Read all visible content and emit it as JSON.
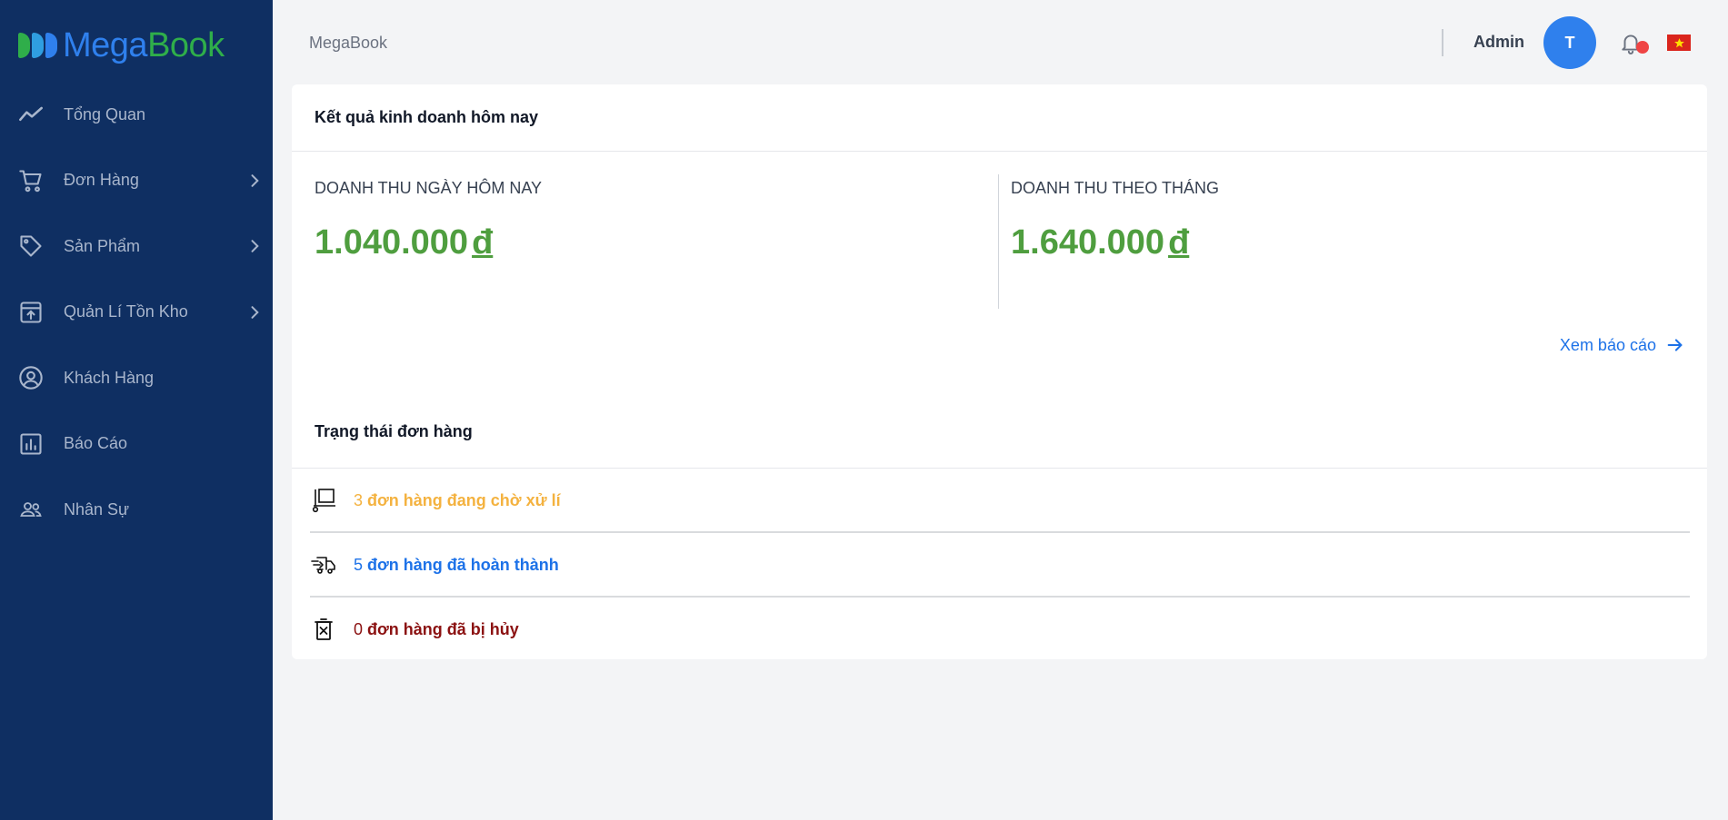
{
  "brand": {
    "name_part1": "Mega",
    "name_part2": "Book",
    "colors": {
      "mega": "#2f80ed",
      "book": "#2fae4a"
    }
  },
  "sidebar": {
    "background": "#0f2f62",
    "items": [
      {
        "label": "Tổng Quan",
        "icon": "trend-line-icon",
        "has_children": false
      },
      {
        "label": "Đơn Hàng",
        "icon": "cart-icon",
        "has_children": true
      },
      {
        "label": "Sản Phẩm",
        "icon": "tag-icon",
        "has_children": true
      },
      {
        "label": "Quản Lí Tồn Kho",
        "icon": "archive-upload-icon",
        "has_children": true
      },
      {
        "label": "Khách Hàng",
        "icon": "user-circle-icon",
        "has_children": false
      },
      {
        "label": "Báo Cáo",
        "icon": "bar-report-icon",
        "has_children": false
      },
      {
        "label": "Nhân Sự",
        "icon": "users-icon",
        "has_children": false
      }
    ]
  },
  "header": {
    "breadcrumb": "MegaBook",
    "user_name": "Admin",
    "avatar_initial": "T",
    "notification_icon": "bell-icon",
    "language_flag": "vietnam-flag-icon"
  },
  "business": {
    "title": "Kết quả kinh doanh hôm nay",
    "today_label": "DOANH THU NGÀY HÔM NAY",
    "today_value": "1.040.000",
    "month_label": "DOANH THU THEO THÁNG",
    "month_value": "1.640.000",
    "currency": "đ",
    "report_link": "Xem báo cáo"
  },
  "orders": {
    "title": "Trạng thái đơn hàng",
    "rows": [
      {
        "count": "3",
        "text": "đơn hàng đang chờ xử lí",
        "color": "#f4b23f",
        "icon": "pallet-icon"
      },
      {
        "count": "5",
        "text": "đơn hàng đã hoàn thành",
        "color": "#1d72e8",
        "icon": "delivery-truck-icon"
      },
      {
        "count": "0",
        "text": "đơn hàng đã bị hủy",
        "color": "#8b1111",
        "icon": "trash-x-icon"
      }
    ]
  }
}
